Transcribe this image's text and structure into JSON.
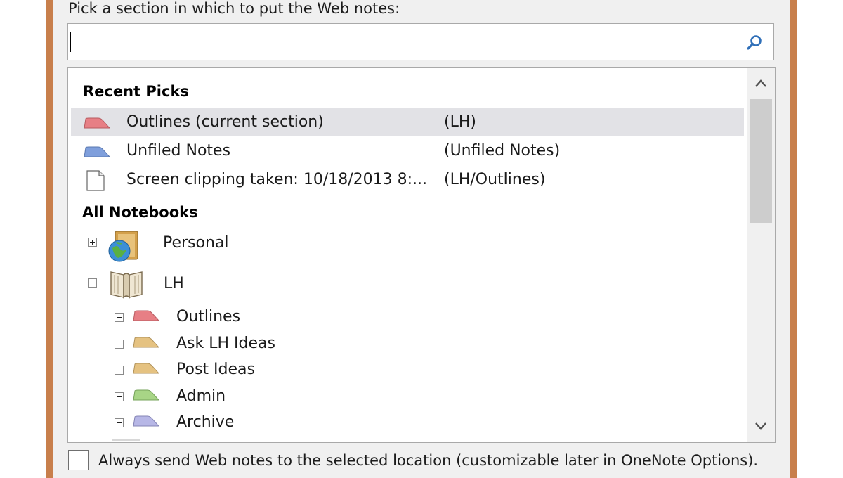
{
  "dialog": {
    "prompt": "Pick a section in which to put the Web notes:",
    "search": {
      "value": "",
      "icon": "search-icon"
    }
  },
  "recent": {
    "heading": "Recent Picks",
    "items": [
      {
        "name": "Outlines (current section)",
        "location": "(LH)",
        "icon": "section-tab-icon",
        "color": "#e77f85",
        "selected": true
      },
      {
        "name": "Unfiled Notes",
        "location": "(Unfiled Notes)",
        "icon": "section-tab-icon",
        "color": "#7f9fdc",
        "selected": false
      },
      {
        "name": "Screen clipping taken: 10/18/2013 8:...",
        "location": "(LH/Outlines)",
        "icon": "page-icon",
        "selected": false
      }
    ]
  },
  "notebooks": {
    "heading": "All Notebooks",
    "items": [
      {
        "name": "Personal",
        "expanded": false,
        "icon": "notebook-globe-icon"
      },
      {
        "name": "LH",
        "expanded": true,
        "icon": "notebook-open-icon",
        "sections": [
          {
            "name": "Outlines",
            "color": "#e77f85"
          },
          {
            "name": "Ask LH Ideas",
            "color": "#e5c281"
          },
          {
            "name": "Post Ideas",
            "color": "#e5c281"
          },
          {
            "name": "Admin",
            "color": "#a8d586"
          },
          {
            "name": "Archive",
            "color": "#b7b7e6"
          }
        ]
      }
    ]
  },
  "options": {
    "always_send_label": "Always send Web notes to the selected location (customizable later in OneNote Options).",
    "always_send_checked": false
  }
}
